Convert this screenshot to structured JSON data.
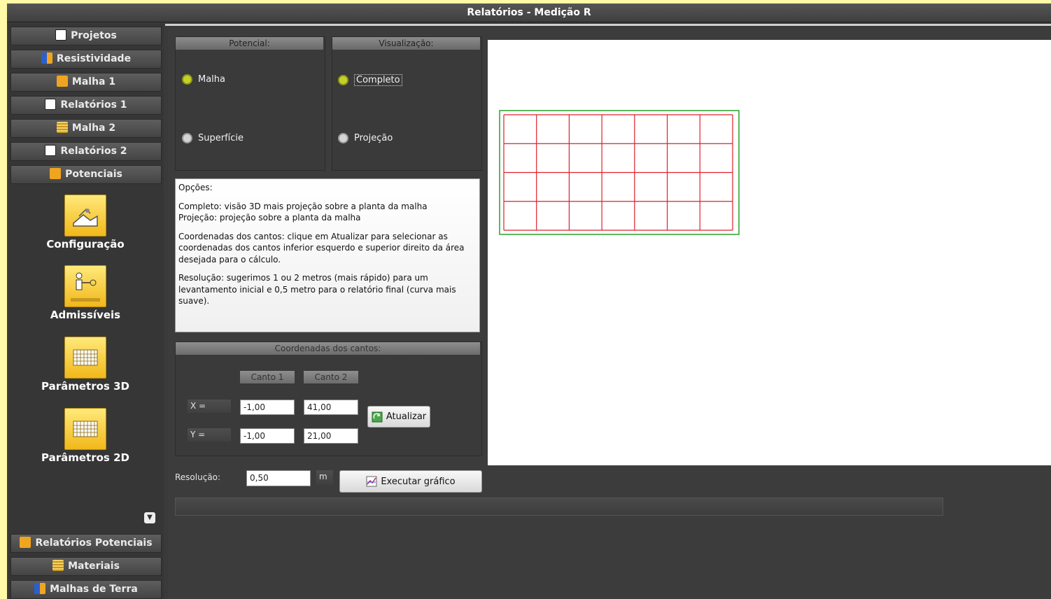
{
  "window": {
    "title": "Relatórios - Medição R"
  },
  "sidebar": {
    "top_items": [
      {
        "label": "Projetos",
        "icon": "document-icon"
      },
      {
        "label": "Resistividade",
        "icon": "resistivity-icon"
      },
      {
        "label": "Malha 1",
        "icon": "mesh-icon"
      },
      {
        "label": "Relatórios 1",
        "icon": "document-icon"
      },
      {
        "label": "Malha 2",
        "icon": "grid-icon"
      },
      {
        "label": "Relatórios 2",
        "icon": "document-icon"
      },
      {
        "label": "Potenciais",
        "icon": "mesh-icon"
      }
    ],
    "tools": [
      {
        "label": "Configuração",
        "icon": "configuration-icon"
      },
      {
        "label": "Admissíveis",
        "icon": "admissible-person-icon"
      },
      {
        "label": "Parâmetros 3D",
        "icon": "grid-3d-icon"
      },
      {
        "label": "Parâmetros 2D",
        "icon": "grid-2d-icon"
      }
    ],
    "bottom_items": [
      {
        "label": "Relatórios Potenciais",
        "icon": "mesh-icon"
      },
      {
        "label": "Materiais",
        "icon": "materials-icon"
      },
      {
        "label": "Malhas de Terra",
        "icon": "ground-mesh-icon"
      }
    ]
  },
  "potencial": {
    "header": "Potencial:",
    "options": [
      "Malha",
      "Superfície"
    ],
    "selected": "Malha"
  },
  "visualizacao": {
    "header": "Visualização:",
    "options": [
      "Completo",
      "Projeção"
    ],
    "selected": "Completo"
  },
  "info": {
    "title": "Opções:",
    "line1": "Completo: visão 3D mais projeção sobre a planta da malha",
    "line2": "Projeção: projeção sobre a planta da malha",
    "para2": "Coordenadas dos cantos: clique em Atualizar para selecionar as coordenadas dos cantos inferior esquerdo e superior direito da área desejada para o cálculo.",
    "para3": "Resolução: sugerimos 1 ou 2 metros (mais rápido) para um levantamento inicial e 0,5 metro para o relatório final (curva mais suave)."
  },
  "coords": {
    "header": "Coordenadas dos cantos:",
    "col1": "Canto 1",
    "col2": "Canto 2",
    "x_label": "X =",
    "y_label": "Y =",
    "x1": "-1,00",
    "x2": "41,00",
    "y1": "-1,00",
    "y2": "21,00",
    "update_button": "Atualizar"
  },
  "resolution": {
    "label": "Resolução:",
    "value": "0,50",
    "unit": "m",
    "run_button": "Executar gráfico"
  },
  "colors": {
    "grid_line": "#e0202a",
    "boundary": "#2aa02a",
    "accent_yellow": "#f1b81a"
  }
}
